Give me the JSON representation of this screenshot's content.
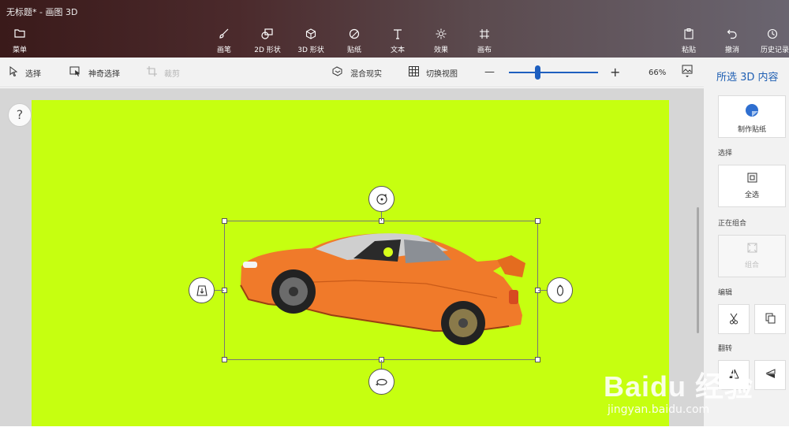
{
  "window": {
    "title": "无标题* - 画图 3D"
  },
  "ribbon": {
    "menu_label": "菜单",
    "tools": [
      {
        "label": "画笔",
        "icon": "brush-icon"
      },
      {
        "label": "2D 形状",
        "icon": "2d-shapes-icon"
      },
      {
        "label": "3D 形状",
        "icon": "3d-shapes-icon"
      },
      {
        "label": "贴纸",
        "icon": "stickers-icon"
      },
      {
        "label": "文本",
        "icon": "text-icon"
      },
      {
        "label": "效果",
        "icon": "effects-icon"
      },
      {
        "label": "画布",
        "icon": "canvas-icon"
      }
    ],
    "paste_label": "粘贴",
    "undo_label": "撤消",
    "history_label": "历史记录"
  },
  "toolbar": {
    "select_label": "选择",
    "magic_select_label": "神奇选择",
    "crop_label": "裁剪",
    "mixed_reality_label": "混合现实",
    "switch_view_label": "切换视图",
    "zoom_minus": "—",
    "zoom_plus": "+",
    "zoom_level": "66%",
    "zoom_slider_fraction": 0.32
  },
  "canvas": {
    "background_color": "#c6ff10",
    "help_label": "?"
  },
  "panel": {
    "title": "所选 3D 内容",
    "make_sticker_label": "制作贴纸",
    "select_section": "选择",
    "select_all_label": "全选",
    "grouping_section": "正在组合",
    "group_label": "组合",
    "edit_section": "编辑",
    "flip_section": "翻转"
  },
  "watermark": {
    "brand": "Baidu 经验",
    "url": "jingyan.baidu.com"
  },
  "colors": {
    "accent": "#1e5fbf",
    "canvas": "#c6ff10",
    "car_body": "#f07a2a"
  }
}
